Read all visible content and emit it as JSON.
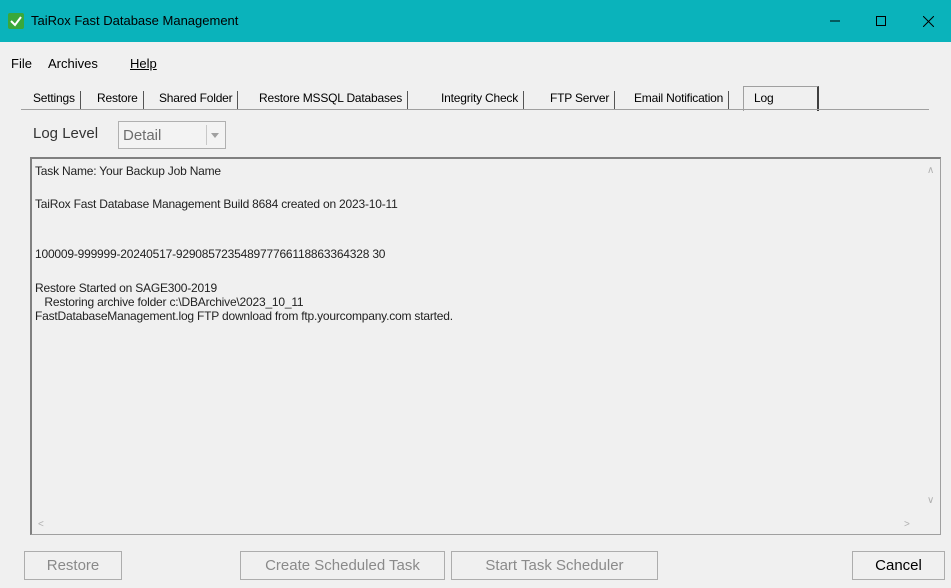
{
  "window": {
    "title": "TaiRox Fast Database Management",
    "controls": [
      "minimize",
      "maximize",
      "close"
    ]
  },
  "menu": {
    "file": "File",
    "archives": "Archives",
    "help": "Help"
  },
  "tabs": [
    {
      "label": "Settings"
    },
    {
      "label": "Restore"
    },
    {
      "label": "Shared Folder"
    },
    {
      "label": "Restore MSSQL Databases"
    },
    {
      "label": "Integrity Check"
    },
    {
      "label": "FTP Server"
    },
    {
      "label": "Email Notification"
    },
    {
      "label": "Log",
      "active": true
    }
  ],
  "log_level": {
    "label": "Log Level",
    "value": "Detail"
  },
  "log": {
    "lines": [
      "Task Name: Your Backup Job Name",
      "TaiRox Fast Database Management Build 8684 created on 2023-10-11",
      "100009-999999-20240517-929085723548977766118863364328 30",
      "Restore Started on SAGE300-2019",
      "   Restoring archive folder c:\\DBArchive\\2023_10_11",
      "FastDatabaseManagement.log FTP download from ftp.yourcompany.com started."
    ]
  },
  "buttons": {
    "restore": "Restore",
    "create_task": "Create Scheduled Task",
    "start_scheduler": "Start Task Scheduler",
    "cancel": "Cancel"
  },
  "colors": {
    "titlebar": "#0ab3bb",
    "window_bg": "#f0f0f0",
    "disabled_text": "#8a8a8a"
  }
}
